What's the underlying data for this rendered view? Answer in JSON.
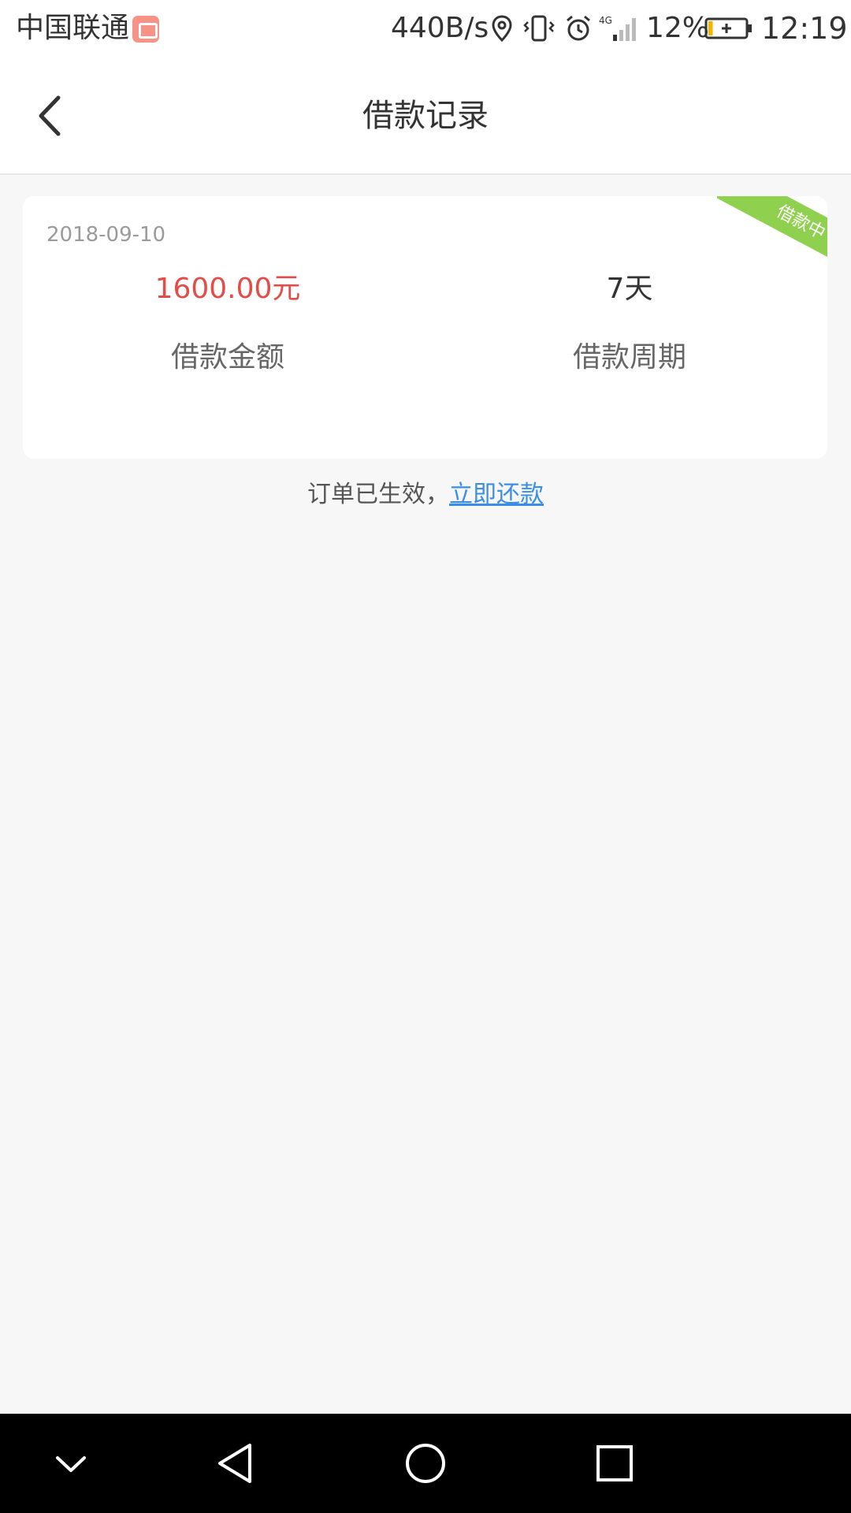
{
  "status_bar": {
    "carrier": "中国联通",
    "network_speed": "440B/s",
    "network_type": "4G",
    "battery_percent": "12%",
    "battery_level": 0.12,
    "time": "12:19",
    "icons": [
      "carrier-badge-icon",
      "location-icon",
      "vibrate-icon",
      "alarm-icon",
      "signal-icon",
      "battery-icon"
    ]
  },
  "header": {
    "title": "借款记录",
    "back_icon": "chevron-left-icon"
  },
  "loan_card": {
    "date": "2018-09-10",
    "status_ribbon": "借款中",
    "amount": "1600.00元",
    "amount_label": "借款金额",
    "period": "7天",
    "period_label": "借款周期"
  },
  "order_notice": {
    "text": "订单已生效，",
    "link": "立即还款"
  },
  "nav_bar": {
    "icons": [
      "hide-keyboard-icon",
      "back-triangle-icon",
      "home-circle-icon",
      "recents-square-icon"
    ]
  },
  "colors": {
    "amount_red": "#e44c47",
    "ribbon_green": "#8fd14f",
    "link_blue": "#3a8ee6",
    "page_background": "#f7f7f7"
  }
}
